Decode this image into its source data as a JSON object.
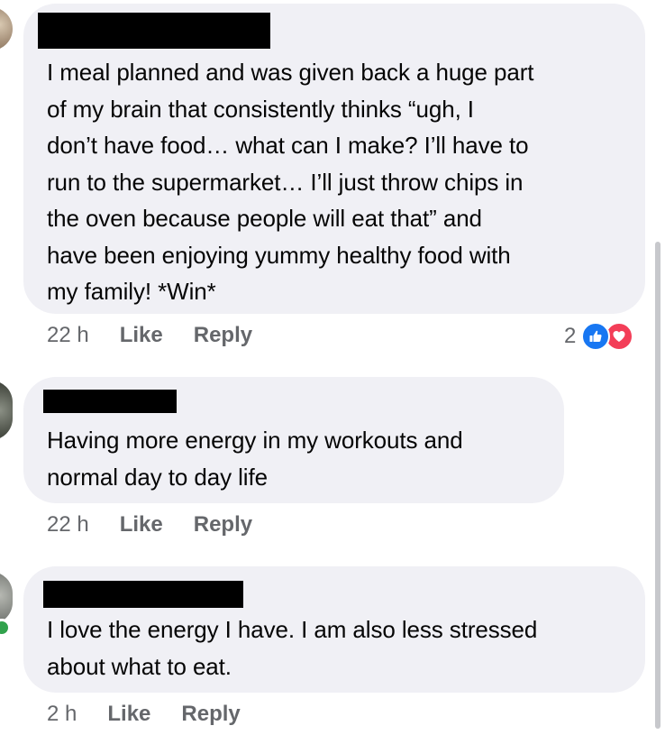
{
  "comments": [
    {
      "text": "I meal planned and was given back a huge part\nof my brain that consistently thinks “ugh, I\ndon’t have food… what can I make? I’ll have to\nrun to the supermarket… I’ll just throw chips in\nthe oven because people will eat that” and\nhave been enjoying yummy healthy food with\nmy family! *Win*",
      "time": "22 h",
      "like_label": "Like",
      "reply_label": "Reply",
      "reaction_count": "2"
    },
    {
      "text": "Having more energy in my workouts and\nnormal day to day life",
      "time": "22 h",
      "like_label": "Like",
      "reply_label": "Reply"
    },
    {
      "text": "I love the energy I have. I am also less stressed\nabout what to eat.",
      "time": "2 h",
      "like_label": "Like",
      "reply_label": "Reply"
    }
  ],
  "icons": {
    "like_reaction": "thumbs-up-icon",
    "love_reaction": "heart-icon"
  },
  "colors": {
    "bubble": "#f0f0f5",
    "meta_text": "#65676b",
    "like_blue": "#1877f2",
    "love_red": "#f33e58",
    "online_green": "#31a24c"
  }
}
